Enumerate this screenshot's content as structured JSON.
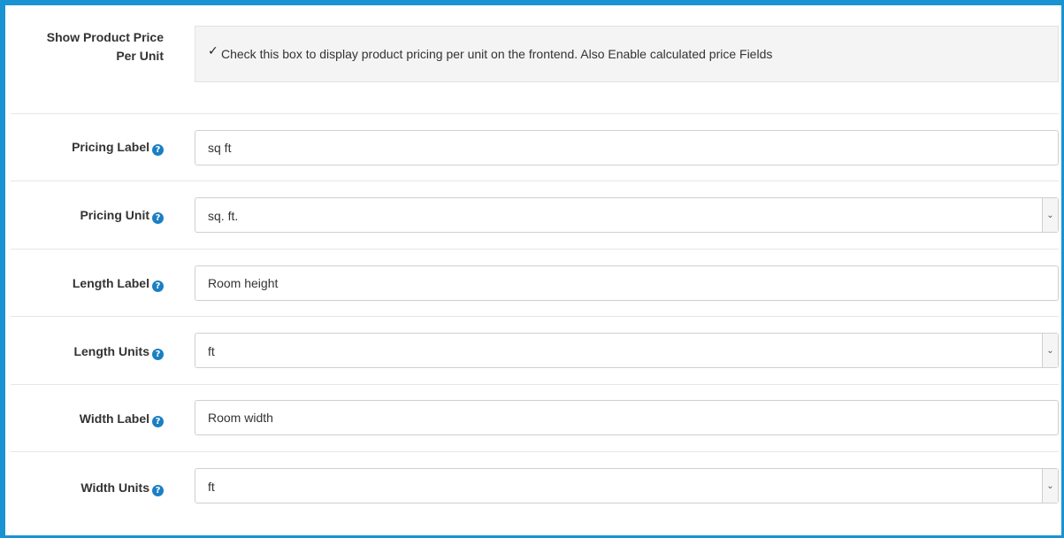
{
  "show_price_per_unit": {
    "label": "Show Product Price Per Unit",
    "checked": true,
    "description": "Check this box to display product pricing per unit on the frontend. Also Enable calculated price Fields"
  },
  "fields": {
    "pricing_label": {
      "label": "Pricing Label",
      "value": "sq ft"
    },
    "pricing_unit": {
      "label": "Pricing Unit",
      "value": "sq. ft."
    },
    "length_label": {
      "label": "Length Label",
      "value": "Room height"
    },
    "length_units": {
      "label": "Length Units",
      "value": "ft"
    },
    "width_label": {
      "label": "Width Label",
      "value": "Room width"
    },
    "width_units": {
      "label": "Width Units",
      "value": "ft"
    }
  },
  "icons": {
    "help": "question-circle-icon",
    "checkbox": "checkmark-icon",
    "select_caret": "chevron-down-icon"
  },
  "colors": {
    "accent": "#1a93d3",
    "help_icon": "#1a7fc4"
  }
}
